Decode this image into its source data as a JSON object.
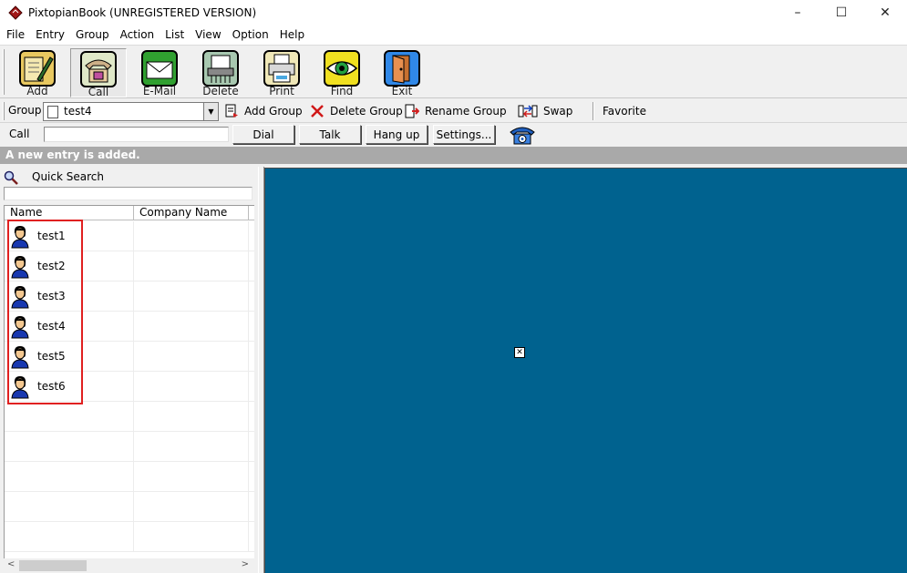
{
  "window": {
    "title": "PixtopianBook (UNREGISTERED VERSION)",
    "minimize": "–",
    "maximize": "☐",
    "close": "✕"
  },
  "menu": [
    "File",
    "Entry",
    "Group",
    "Action",
    "List",
    "View",
    "Option",
    "Help"
  ],
  "toolbar": {
    "buttons": [
      {
        "label": "Add",
        "icon": "add-entry-icon"
      },
      {
        "label": "Call",
        "icon": "telephone-icon"
      },
      {
        "label": "E-Mail",
        "icon": "email-envelope-icon"
      },
      {
        "label": "Delete",
        "icon": "shredder-icon"
      },
      {
        "label": "Print",
        "icon": "printer-icon"
      },
      {
        "label": "Find",
        "icon": "eye-icon"
      },
      {
        "label": "Exit",
        "icon": "exit-door-icon"
      }
    ]
  },
  "groupbar": {
    "label": "Group",
    "selected": "test4",
    "add_group": "Add Group",
    "delete_group": "Delete Group",
    "rename_group": "Rename Group",
    "swap": "Swap",
    "favorite": "Favorite"
  },
  "callbar": {
    "label": "Call",
    "number": "",
    "dial": "Dial",
    "talk": "Talk",
    "hang_up": "Hang up",
    "settings": "Settings..."
  },
  "status": "A new entry is added.",
  "quick_search": {
    "label": "Quick Search",
    "value": ""
  },
  "list": {
    "columns": [
      "Name",
      "Company Name"
    ],
    "rows": [
      {
        "name": "test1",
        "company": ""
      },
      {
        "name": "test2",
        "company": ""
      },
      {
        "name": "test3",
        "company": ""
      },
      {
        "name": "test4",
        "company": ""
      },
      {
        "name": "test5",
        "company": ""
      },
      {
        "name": "test6",
        "company": ""
      },
      {
        "name": "",
        "company": ""
      },
      {
        "name": "",
        "company": ""
      },
      {
        "name": "",
        "company": ""
      },
      {
        "name": "",
        "company": ""
      },
      {
        "name": "",
        "company": ""
      }
    ]
  },
  "colors": {
    "preview_background": "#00628f",
    "status_banner": "#a9a9a9",
    "selection_highlight": "#e02020"
  }
}
